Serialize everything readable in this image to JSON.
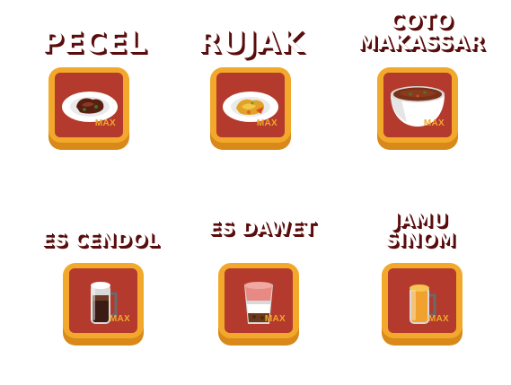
{
  "items": [
    {
      "id": "pecel",
      "title_lines": [
        "PECEL"
      ],
      "badge": "MAX",
      "icon": "pecel-plate-icon"
    },
    {
      "id": "rujak",
      "title_lines": [
        "RUJAK"
      ],
      "badge": "MAX",
      "icon": "rujak-plate-icon"
    },
    {
      "id": "coto",
      "title_lines": [
        "COTO",
        "MAKASSAR"
      ],
      "badge": "MAX",
      "icon": "coto-bowl-icon"
    },
    {
      "id": "cendol",
      "title_lines": [
        "ES CENDOL"
      ],
      "badge": "MAX",
      "icon": "es-cendol-glass-icon"
    },
    {
      "id": "dawet",
      "title_lines": [
        "ES DAWET"
      ],
      "badge": "MAX",
      "icon": "es-dawet-glass-icon"
    },
    {
      "id": "jamu",
      "title_lines": [
        "JAMU",
        "SINOM"
      ],
      "badge": "MAX",
      "icon": "jamu-sinom-mug-icon"
    }
  ],
  "colors": {
    "tile_frame": "#f2a92b",
    "tile_shadow": "#d9891a",
    "tile_inner": "#b33a2c",
    "title_shadow": "#5a0d0d",
    "badge": "#f2a92b"
  }
}
